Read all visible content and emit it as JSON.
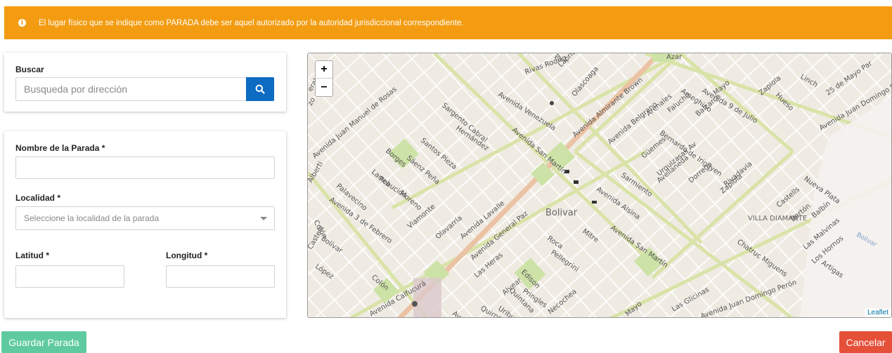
{
  "alert": {
    "icon": "info-icon",
    "message": "El lugar físico que se indique como PARADA debe ser aquel autorizado por la autoridad jurisdiccional correspondiente.",
    "color": "#f39c12"
  },
  "search": {
    "label": "Buscar",
    "placeholder": "Busqueda por dirección",
    "button_icon": "search-icon",
    "button_color": "#0d6bc1"
  },
  "form": {
    "name_label": "Nombre de la Parada *",
    "name_value": "",
    "locality_label": "Localidad *",
    "locality_placeholder": "Seleccione la localidad de la parada",
    "lat_label": "Latitud *",
    "lat_value": "",
    "lon_label": "Longitud *",
    "lon_value": ""
  },
  "map": {
    "zoom_in": "+",
    "zoom_out": "−",
    "attribution": "Leaflet",
    "places": [
      "Bolivar",
      "VILLA DIAMANTE",
      "Bolivar"
    ],
    "streets": [
      "Avenida Venezuela",
      "Rivas Rodrig",
      "Laprida",
      "Olascoaga",
      "Avenida Almirante Brown",
      "Avenida Belgrano",
      "Ameghino",
      "Avenida 9 de Julio",
      "Hueso",
      "Linch",
      "25 de Mayo Par",
      "Avenida Juan Domingo Perón",
      "Sargento Cabral",
      "Hernández",
      "Santos Pieza",
      "Sáenz Peña",
      "Borges",
      "Larrea",
      "Palavecino",
      "Alberti",
      "Avenida Juan Manuel de Rosas",
      "Avenida San Martín",
      "Arenales",
      "Güemes",
      "Falucho",
      "Balcarce",
      "Bernardo de Irigoyen",
      "Urquiza",
      "Avellaneda",
      "Dorrego",
      "Zapiola",
      "Zapiola",
      "Rivadavia",
      "Sarmiento",
      "Avenida Alsina",
      "Mitre",
      "Roca",
      "Rebución",
      "Moreno",
      "Viamonte",
      "Olavarría",
      "Avenida Lavalle",
      "Avenida General Paz",
      "Avenida 3 de Febrero",
      "Colón",
      "Castelli",
      "Bolívar",
      "Colón",
      "Las Heras",
      "Pellegrini",
      "Edison",
      "Alvear",
      "Quintana",
      "Pringles",
      "Uriburu",
      "Necochea",
      "Avenida San Martín",
      "Chatruc Miguens",
      "Castells",
      "Bertón",
      "Balbín",
      "Nueva Plata",
      "Las Malvinas",
      "Los Hornos",
      "Artigas",
      "Las Glicinas",
      "Avenida Calfucurá",
      "Quirno",
      "Mayo",
      "Mayo",
      "López",
      "Ave",
      "Azar",
      "Pa",
      "zo",
      "eral",
      "Avenida Juan Domingo Perón",
      "sas Av"
    ]
  },
  "buttons": {
    "save": "Guardar Parada",
    "cancel": "Cancelar",
    "save_color": "#5fcaa0",
    "cancel_color": "#e55039"
  }
}
